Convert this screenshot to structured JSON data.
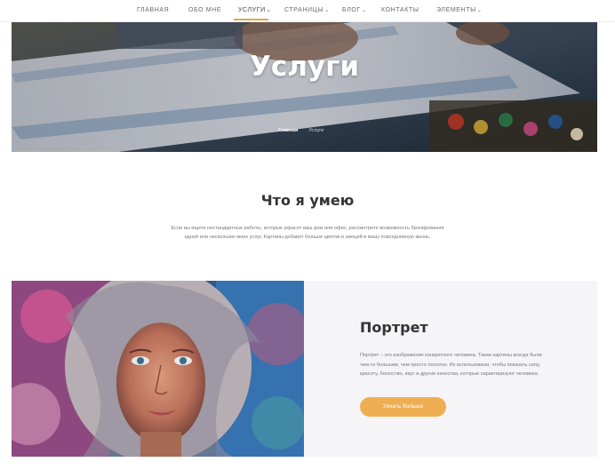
{
  "nav": {
    "items": [
      {
        "label": "ГЛАВНАЯ",
        "has_dropdown": false
      },
      {
        "label": "ОБО МНЕ",
        "has_dropdown": false
      },
      {
        "label": "УСЛУГИ",
        "has_dropdown": true,
        "active": true
      },
      {
        "label": "СТРАНИЦЫ",
        "has_dropdown": true
      },
      {
        "label": "БЛОГ",
        "has_dropdown": true
      },
      {
        "label": "КОНТАКТЫ",
        "has_dropdown": false
      },
      {
        "label": "ЭЛЕМЕНТЫ",
        "has_dropdown": true
      }
    ],
    "dropdown_glyph": "⌄",
    "active_color": "#e0a948"
  },
  "hero": {
    "title": "Услуги",
    "breadcrumb": {
      "home": "Главная",
      "current": "Услуги"
    }
  },
  "skills": {
    "title": "Что я умею",
    "text_line1": "Если вы ищете нестандартные работы, которые украсят ваш дом или офис, рассмотрите возможность бронирования",
    "text_line2": "одной или нескольких моих услуг. Картины добавят больше цветов и эмоций в вашу повседневную жизнь."
  },
  "portrait": {
    "title": "Портрет",
    "text": "Портрет – это изображение конкретного человека. Такие картины всегда были чем-то большим, чем просто полотно. Их использовали, чтобы показать силу, красоту, богатство, вкус и другие качества, которые характеризуют человека.",
    "button_label": "Узнать больше",
    "button_color": "#efae52"
  }
}
